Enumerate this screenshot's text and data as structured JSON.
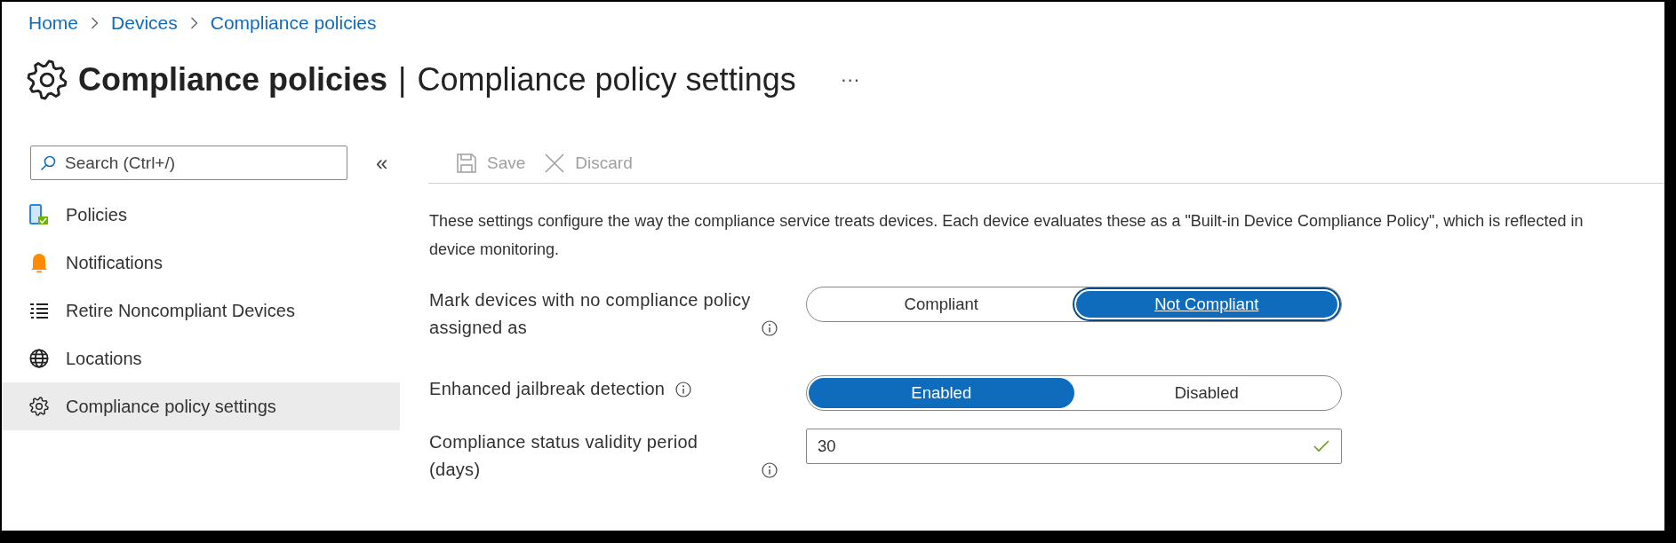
{
  "breadcrumb": [
    {
      "label": "Home"
    },
    {
      "label": "Devices"
    },
    {
      "label": "Compliance policies"
    }
  ],
  "header": {
    "title": "Compliance policies",
    "subtitle": "Compliance policy settings",
    "separator": "|",
    "more": "···"
  },
  "sidebar": {
    "search": {
      "placeholder": "Search (Ctrl+/)"
    },
    "collapse": "«",
    "items": [
      {
        "label": "Policies",
        "selected": false
      },
      {
        "label": "Notifications",
        "selected": false
      },
      {
        "label": "Retire Noncompliant Devices",
        "selected": false
      },
      {
        "label": "Locations",
        "selected": false
      },
      {
        "label": "Compliance policy settings",
        "selected": true
      }
    ]
  },
  "toolbar": [
    {
      "label": "Save",
      "kind": "save",
      "disabled": true
    },
    {
      "label": "Discard",
      "kind": "discard",
      "disabled": true
    }
  ],
  "description": "These settings configure the way the compliance service treats devices. Each device evaluates these as a \"Built-in Device Compliance Policy\", which is reflected in device monitoring.",
  "settings": [
    {
      "kind": "toggle",
      "label": "Mark devices with no compliance policy assigned as",
      "focused": true,
      "options": [
        {
          "label": "Compliant",
          "selected": false
        },
        {
          "label": "Not Compliant",
          "selected": true
        }
      ]
    },
    {
      "kind": "toggle",
      "label": "Enhanced jailbreak detection",
      "focused": false,
      "options": [
        {
          "label": "Enabled",
          "selected": true
        },
        {
          "label": "Disabled",
          "selected": false
        }
      ]
    },
    {
      "kind": "text",
      "label": "Compliance status validity period (days)",
      "value": "30",
      "valid": true
    }
  ]
}
